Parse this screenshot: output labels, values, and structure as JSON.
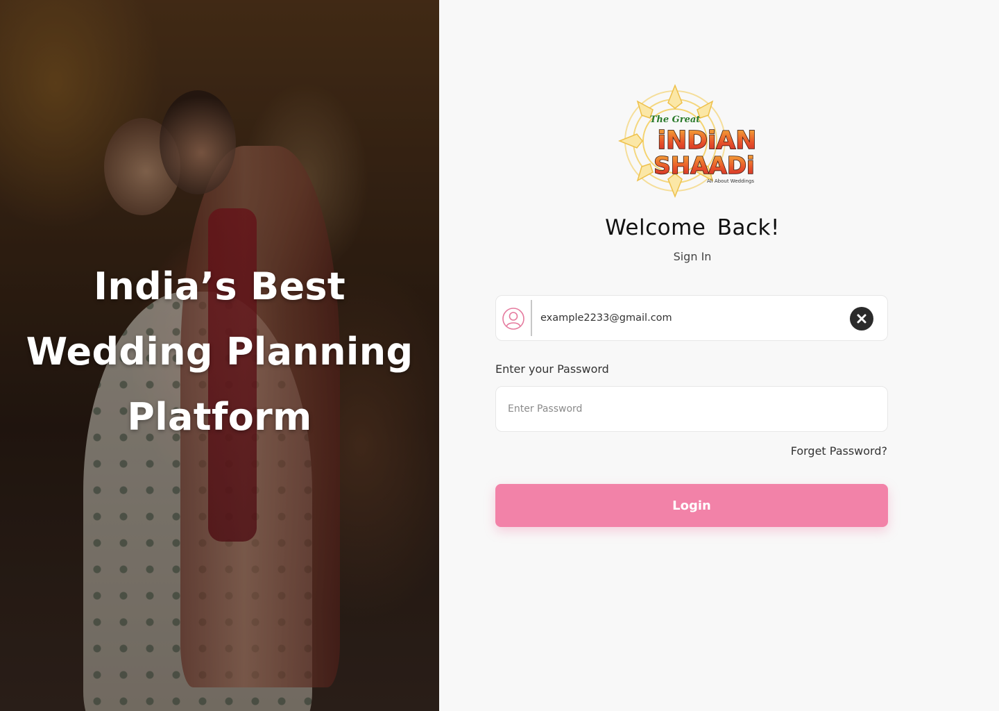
{
  "hero": {
    "line1": "India’s Best",
    "line2": "Wedding Planning",
    "line3": "Platform"
  },
  "logo": {
    "top_text": "The Great",
    "word1": "iNDiAN",
    "word2": "SHAADi",
    "tagline": "All About Weddings"
  },
  "login": {
    "welcome": "Welcome  Back!",
    "subtitle": "Sign In",
    "email_value": "example2233@gmail.com",
    "password_label": "Enter your Password",
    "password_placeholder": "Enter Password",
    "forgot_label": "Forget Password?",
    "login_label": "Login"
  },
  "colors": {
    "accent": "#f282a8",
    "icon_pink": "#e57a9e",
    "clear_button": "#2b2b2b",
    "background": "#f8f8f8"
  },
  "icons": {
    "email_icon": "user-circle-icon",
    "clear_icon": "close-icon"
  }
}
